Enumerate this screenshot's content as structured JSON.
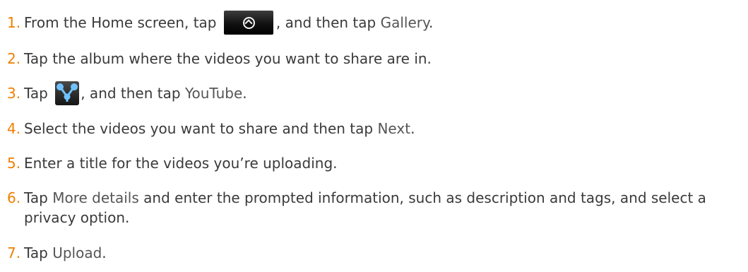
{
  "steps": [
    {
      "number": "1.",
      "text_before": "From the Home screen, tap",
      "icon": "all-apps-icon",
      "text_after": ", and then tap",
      "ui_label": "Gallery",
      "text_end": "."
    },
    {
      "number": "2.",
      "text": "Tap the album where the videos you want to share are in."
    },
    {
      "number": "3.",
      "text_before": "Tap",
      "icon": "share-icon",
      "text_after": ", and then tap",
      "ui_label": "YouTube",
      "text_end": "."
    },
    {
      "number": "4.",
      "text_before": "Select the videos you want to share and then tap",
      "ui_label": "Next",
      "text_end": "."
    },
    {
      "number": "5.",
      "text": "Enter a title for the videos you’re uploading."
    },
    {
      "number": "6.",
      "text_before": "Tap",
      "ui_label": "More details",
      "text_after": "and enter the prompted information, such as description and tags, and select a privacy option."
    },
    {
      "number": "7.",
      "text_before": "Tap",
      "ui_label": "Upload",
      "text_end": "."
    }
  ],
  "colors": {
    "number": "#f07f00",
    "body_text": "#3a3a3a"
  }
}
